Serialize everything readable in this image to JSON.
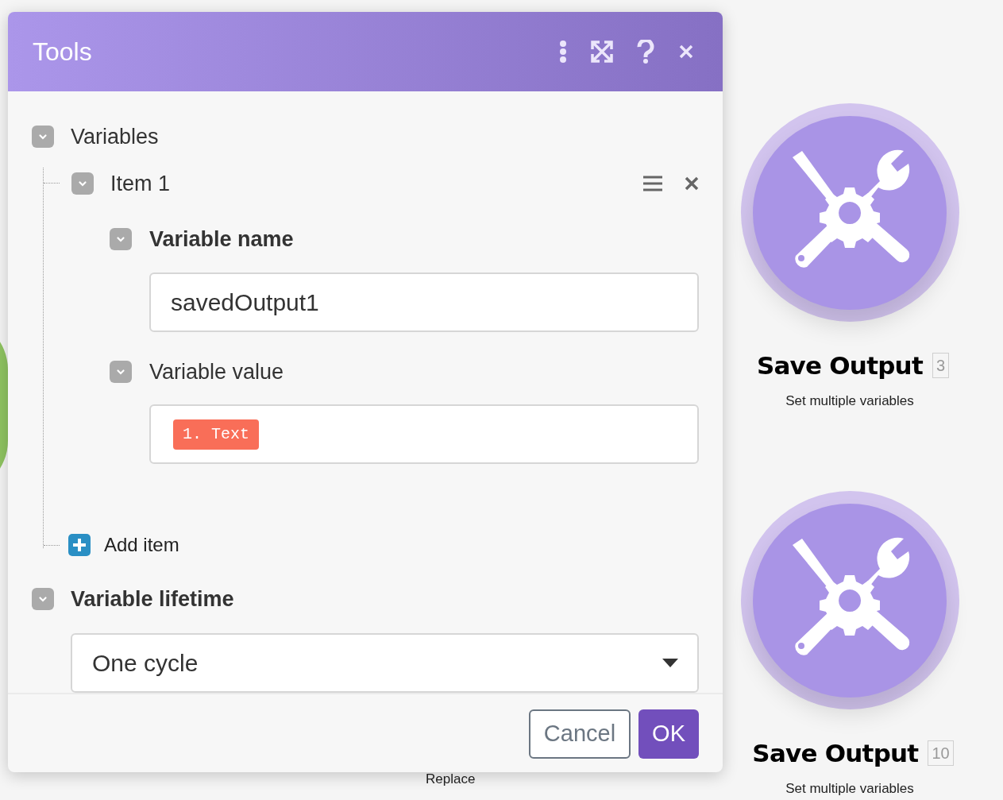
{
  "canvas": {
    "nodes": [
      {
        "title": "Save Output",
        "badge": "3",
        "subtitle": "Set multiple variables"
      },
      {
        "title": "Save Output",
        "badge": "10",
        "subtitle": "Set multiple variables"
      }
    ],
    "hidden_label": "Replace"
  },
  "dialog": {
    "title": "Tools",
    "variables": {
      "label": "Variables",
      "expanded": true,
      "items": [
        {
          "label": "Item 1",
          "expanded": true,
          "fields": [
            {
              "kind": "text",
              "label": "Variable name",
              "expanded": true,
              "required": true,
              "value": "savedOutput1"
            },
            {
              "kind": "tokens",
              "label": "Variable value",
              "expanded": true,
              "required": false,
              "tokens": [
                "1. Text"
              ]
            }
          ]
        }
      ],
      "add_label": "Add item"
    },
    "lifetime": {
      "label": "Variable lifetime",
      "expanded": true,
      "required": true,
      "value": "One cycle"
    },
    "buttons": [
      {
        "kind": "secondary",
        "label": "Cancel"
      },
      {
        "kind": "primary",
        "label": "OK"
      }
    ]
  }
}
